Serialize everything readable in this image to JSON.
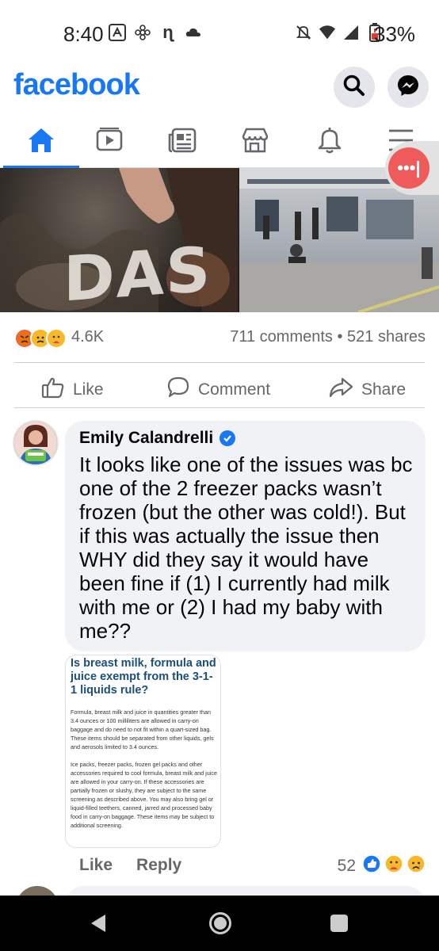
{
  "status_bar": {
    "time": "8:40",
    "battery": "33%",
    "left_icons": [
      "fitness-icon",
      "flower-icon",
      "n-app-icon",
      "cloud-icon"
    ],
    "right_icons": [
      "mute-icon",
      "wifi-icon",
      "signal-icon",
      "battery-icon"
    ]
  },
  "header": {
    "logo": "facebook",
    "search_icon": "search-icon",
    "messenger_icon": "messenger-icon"
  },
  "nav": {
    "tabs": [
      "home",
      "watch",
      "news",
      "marketplace",
      "notifications",
      "menu"
    ],
    "active": "home"
  },
  "post": {
    "image_text": "DAS",
    "reaction_count": "4.6K",
    "comments_shares": "711 comments • 521 shares",
    "actions": {
      "like": "Like",
      "comment": "Comment",
      "share": "Share"
    }
  },
  "comment": {
    "author": "Emily Calandrelli",
    "text": "It looks like one of the issues was bc one of the 2 freezer packs wasn’t frozen (but the other was cold!). But if this was actually the issue then WHY did they say it would have been fine if (1) I currently had milk with me or (2) I had my baby with me??",
    "attachment": {
      "title": "Is breast milk, formula and juice exempt from the 3-1-1 liquids rule?",
      "paragraph1": "Formula, breast milk and juice in quantities greater than 3.4 ounces or 100 milliliters are allowed in carry-on baggage and do need to not fit within a quart-sized bag. These items should be separated from other liquids, gels and aerosols limited to 3.4 ounces.",
      "paragraph2": "Ice packs, freezer packs, frozen gel packs and other accessories required to cool formula, breast milk and juice are allowed in your carry-on. If these accessories are partially frozen or slushy, they are subject to the same screening as described above. You may also bring gel or liquid-filled teethers, canned, jarred and processed baby food in carry-on baggage. These items may be subject to additional screening."
    },
    "like_label": "Like",
    "reply_label": "Reply",
    "reaction_count": "52"
  },
  "colors": {
    "brand": "#1877f2",
    "secondary_text": "#65676b",
    "bubble": "#f0f2f5"
  }
}
